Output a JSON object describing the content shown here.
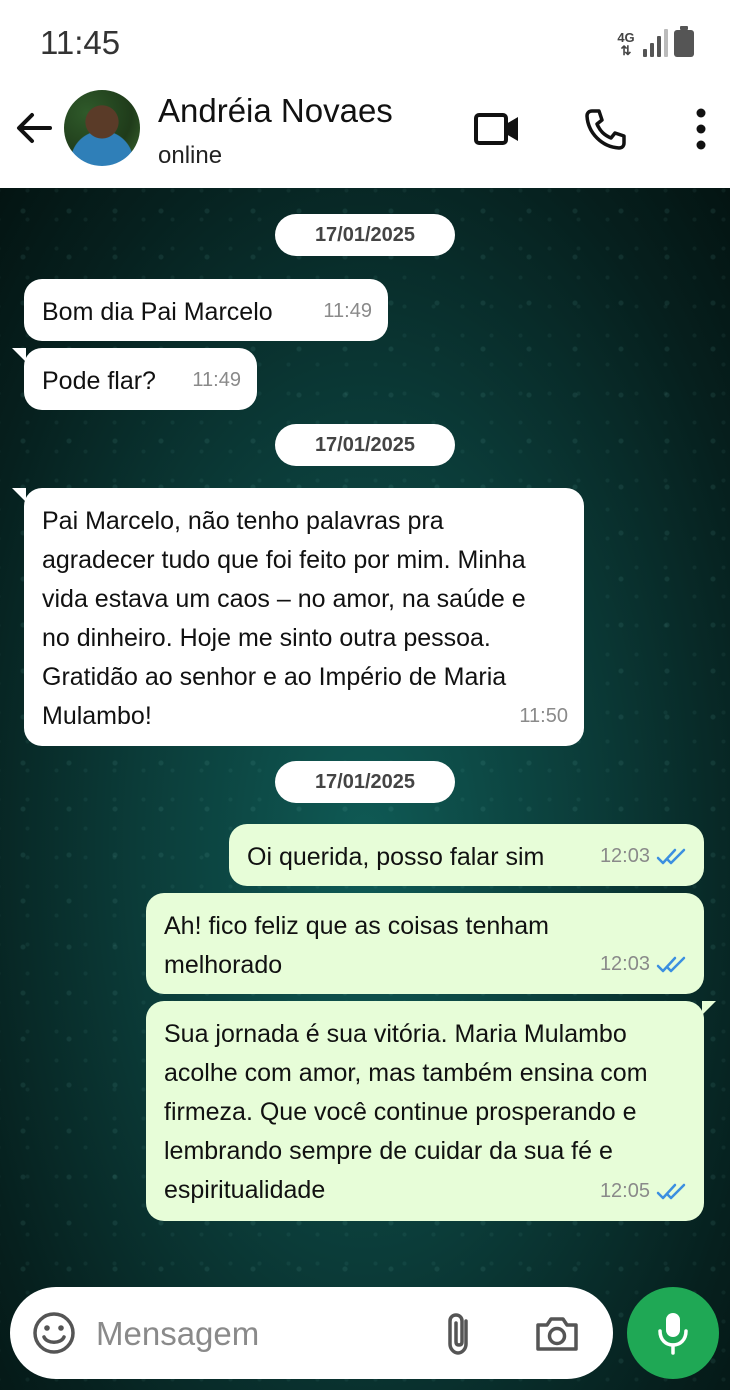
{
  "status_bar": {
    "time": "11:45",
    "network": "4G"
  },
  "header": {
    "contact_name": "Andréia Novaes",
    "contact_status": "online"
  },
  "messages": [
    {
      "type": "date",
      "text": "17/01/2025"
    },
    {
      "type": "incoming",
      "text": "Bom dia Pai Marcelo",
      "time": "11:49"
    },
    {
      "type": "incoming",
      "text": "Pode flar?",
      "time": "11:49"
    },
    {
      "type": "date",
      "text": "17/01/2025"
    },
    {
      "type": "incoming",
      "text": "Pai Marcelo, não tenho palavras pra agradecer tudo que foi feito por mim. Minha vida estava um caos – no amor, na saúde e no dinheiro. Hoje me sinto outra pessoa. Gratidão ao senhor e ao Império de Maria Mulambo!",
      "time": "11:50"
    },
    {
      "type": "date",
      "text": "17/01/2025"
    },
    {
      "type": "outgoing",
      "text": "Oi querida, posso falar sim",
      "time": "12:03",
      "status": "read"
    },
    {
      "type": "outgoing",
      "text": "Ah! fico feliz que as coisas tenham melhorado",
      "time": "12:03",
      "status": "read"
    },
    {
      "type": "outgoing",
      "text": "Sua jornada é sua vitória. Maria Mulambo acolhe com amor, mas também ensina com firmeza. Que você continue prosperando e lembrando sempre de cuidar da sua fé e espiritualidade",
      "time": "12:05",
      "status": "read"
    }
  ],
  "input": {
    "placeholder": "Mensagem"
  },
  "colors": {
    "accent": "#1fa855",
    "outgoing_bubble": "#e7fdd8",
    "read_ticks": "#3b8fe0"
  },
  "icons": [
    "back-arrow-icon",
    "video-call-icon",
    "phone-icon",
    "more-vert-icon",
    "emoji-icon",
    "attach-icon",
    "camera-icon",
    "mic-icon",
    "double-check-icon"
  ]
}
